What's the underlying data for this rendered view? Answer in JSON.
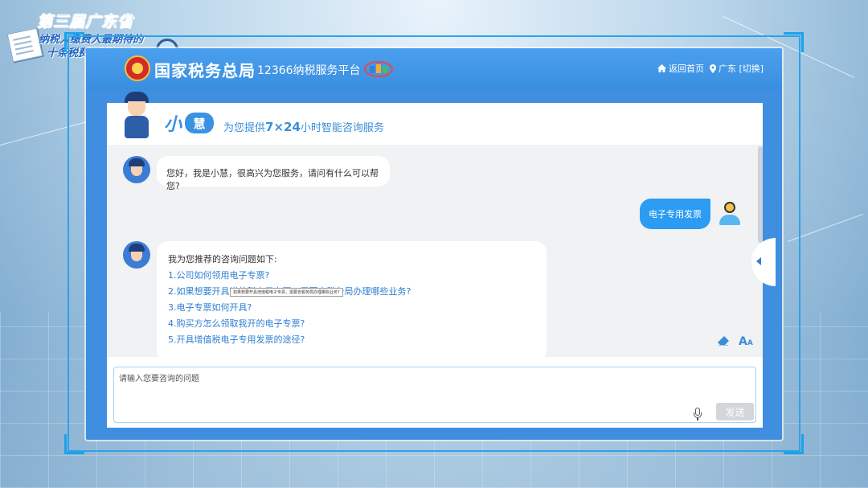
{
  "event": {
    "line1": "第三届广东省",
    "line2": "纳税人缴费人最期待的",
    "line3": "十条税费服务举措"
  },
  "header": {
    "agency_name": "国家税务总局",
    "platform_name": "12366纳税服务平台",
    "home_label": "返回首页",
    "region_label": "广东 [切换]"
  },
  "banner": {
    "brand_small": "小",
    "brand_robot": "慧",
    "slogan_prefix": "为您提供",
    "slogan_hours": "7×24",
    "slogan_suffix": "小时智能咨询服务"
  },
  "chat": {
    "greeting": "您好，我是小慧，很高兴为您服务，请问有什么可以帮您?",
    "user_message": "电子专用发票",
    "suggest_title": "我为您推荐的咨询问题如下:",
    "suggestions": [
      "1.公司如何领用电子专票?",
      "2.如果想要开具增值税电子专票，需要去税务局办理哪些业务?",
      "3.电子专票如何开具?",
      "4.购买方怎么领取我开的电子专票?",
      "5.开具增值税电子专用发票的途径?"
    ],
    "tooltip": "如果想要开具增值税电子专票，需要去税务局办理哪些业务?"
  },
  "input": {
    "placeholder": "请输入您要咨询的问题",
    "send_label": "发送"
  },
  "icons": {
    "home": "home-icon",
    "location": "location-pin-icon",
    "mic": "microphone-icon",
    "clear": "eraser-icon",
    "font": "font-size-icon",
    "collapse": "chevron-left-icon"
  },
  "colors": {
    "header_blue": "#3f8ee0",
    "link_blue": "#2f7fd2",
    "user_bubble": "#2b9cf2",
    "frame_cyan": "#1aa3ea"
  }
}
